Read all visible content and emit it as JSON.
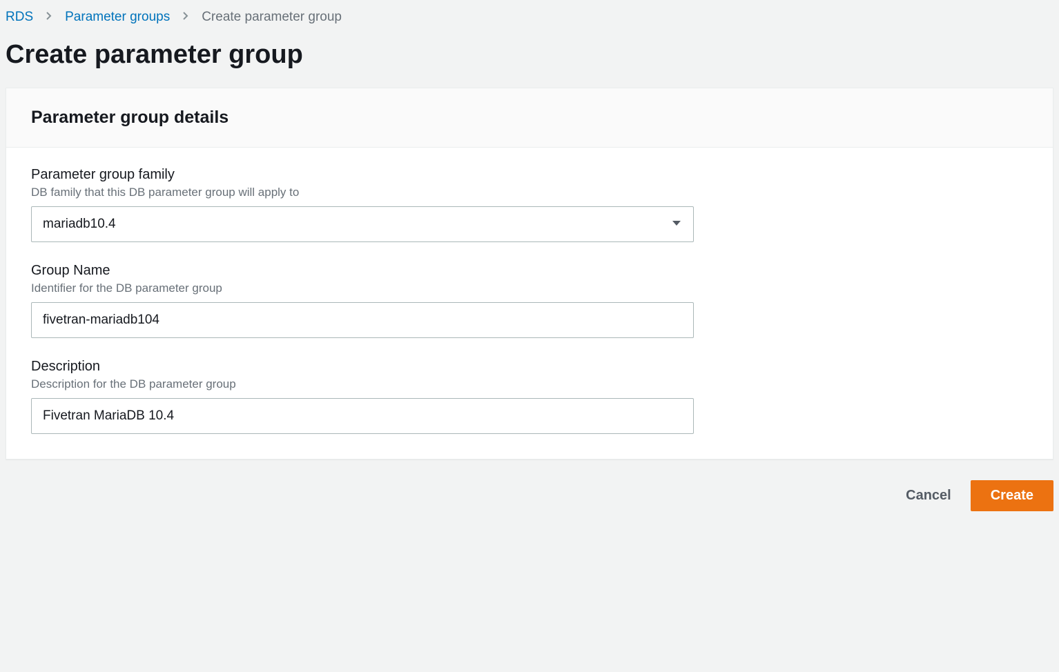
{
  "breadcrumb": {
    "items": [
      {
        "label": "RDS",
        "link": true
      },
      {
        "label": "Parameter groups",
        "link": true
      },
      {
        "label": "Create parameter group",
        "link": false
      }
    ]
  },
  "page": {
    "title": "Create parameter group"
  },
  "panel": {
    "title": "Parameter group details"
  },
  "form": {
    "family": {
      "label": "Parameter group family",
      "hint": "DB family that this DB parameter group will apply to",
      "value": "mariadb10.4"
    },
    "group_name": {
      "label": "Group Name",
      "hint": "Identifier for the DB parameter group",
      "value": "fivetran-mariadb104"
    },
    "description": {
      "label": "Description",
      "hint": "Description for the DB parameter group",
      "value": "Fivetran MariaDB 10.4"
    }
  },
  "actions": {
    "cancel": "Cancel",
    "create": "Create"
  }
}
